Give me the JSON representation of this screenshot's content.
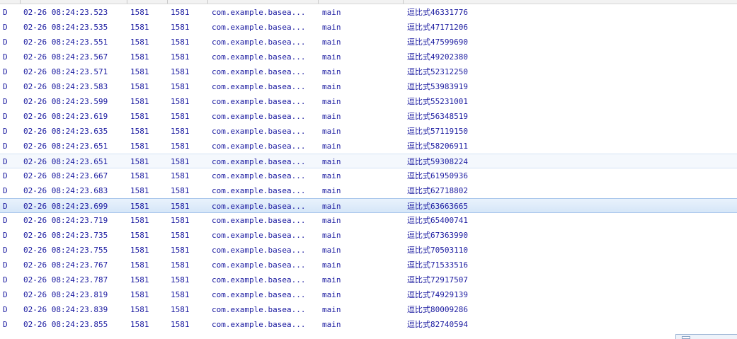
{
  "logcat": {
    "rows": [
      {
        "level": "D",
        "time": "02-26 08:24:23.523",
        "pid": "1581",
        "tid": "1581",
        "application": "com.example.basea...",
        "tag": "main",
        "text": "逗比式46331776"
      },
      {
        "level": "D",
        "time": "02-26 08:24:23.535",
        "pid": "1581",
        "tid": "1581",
        "application": "com.example.basea...",
        "tag": "main",
        "text": "逗比式47171206"
      },
      {
        "level": "D",
        "time": "02-26 08:24:23.551",
        "pid": "1581",
        "tid": "1581",
        "application": "com.example.basea...",
        "tag": "main",
        "text": "逗比式47599690"
      },
      {
        "level": "D",
        "time": "02-26 08:24:23.567",
        "pid": "1581",
        "tid": "1581",
        "application": "com.example.basea...",
        "tag": "main",
        "text": "逗比式49202380"
      },
      {
        "level": "D",
        "time": "02-26 08:24:23.571",
        "pid": "1581",
        "tid": "1581",
        "application": "com.example.basea...",
        "tag": "main",
        "text": "逗比式52312250"
      },
      {
        "level": "D",
        "time": "02-26 08:24:23.583",
        "pid": "1581",
        "tid": "1581",
        "application": "com.example.basea...",
        "tag": "main",
        "text": "逗比式53983919"
      },
      {
        "level": "D",
        "time": "02-26 08:24:23.599",
        "pid": "1581",
        "tid": "1581",
        "application": "com.example.basea...",
        "tag": "main",
        "text": "逗比式55231001"
      },
      {
        "level": "D",
        "time": "02-26 08:24:23.619",
        "pid": "1581",
        "tid": "1581",
        "application": "com.example.basea...",
        "tag": "main",
        "text": "逗比式56348519"
      },
      {
        "level": "D",
        "time": "02-26 08:24:23.635",
        "pid": "1581",
        "tid": "1581",
        "application": "com.example.basea...",
        "tag": "main",
        "text": "逗比式57119150"
      },
      {
        "level": "D",
        "time": "02-26 08:24:23.651",
        "pid": "1581",
        "tid": "1581",
        "application": "com.example.basea...",
        "tag": "main",
        "text": "逗比式58206911"
      },
      {
        "level": "D",
        "time": "02-26 08:24:23.651",
        "pid": "1581",
        "tid": "1581",
        "application": "com.example.basea...",
        "tag": "main",
        "text": "逗比式59308224"
      },
      {
        "level": "D",
        "time": "02-26 08:24:23.667",
        "pid": "1581",
        "tid": "1581",
        "application": "com.example.basea...",
        "tag": "main",
        "text": "逗比式61950936"
      },
      {
        "level": "D",
        "time": "02-26 08:24:23.683",
        "pid": "1581",
        "tid": "1581",
        "application": "com.example.basea...",
        "tag": "main",
        "text": "逗比式62718802"
      },
      {
        "level": "D",
        "time": "02-26 08:24:23.699",
        "pid": "1581",
        "tid": "1581",
        "application": "com.example.basea...",
        "tag": "main",
        "text": "逗比式63663665"
      },
      {
        "level": "D",
        "time": "02-26 08:24:23.719",
        "pid": "1581",
        "tid": "1581",
        "application": "com.example.basea...",
        "tag": "main",
        "text": "逗比式65400741"
      },
      {
        "level": "D",
        "time": "02-26 08:24:23.735",
        "pid": "1581",
        "tid": "1581",
        "application": "com.example.basea...",
        "tag": "main",
        "text": "逗比式67363990"
      },
      {
        "level": "D",
        "time": "02-26 08:24:23.755",
        "pid": "1581",
        "tid": "1581",
        "application": "com.example.basea...",
        "tag": "main",
        "text": "逗比式70503110"
      },
      {
        "level": "D",
        "time": "02-26 08:24:23.767",
        "pid": "1581",
        "tid": "1581",
        "application": "com.example.basea...",
        "tag": "main",
        "text": "逗比式71533516"
      },
      {
        "level": "D",
        "time": "02-26 08:24:23.787",
        "pid": "1581",
        "tid": "1581",
        "application": "com.example.basea...",
        "tag": "main",
        "text": "逗比式72917507"
      },
      {
        "level": "D",
        "time": "02-26 08:24:23.819",
        "pid": "1581",
        "tid": "1581",
        "application": "com.example.basea...",
        "tag": "main",
        "text": "逗比式74929139"
      },
      {
        "level": "D",
        "time": "02-26 08:24:23.839",
        "pid": "1581",
        "tid": "1581",
        "application": "com.example.basea...",
        "tag": "main",
        "text": "逗比式80009286"
      },
      {
        "level": "D",
        "time": "02-26 08:24:23.855",
        "pid": "1581",
        "tid": "1581",
        "application": "com.example.basea...",
        "tag": "main",
        "text": "逗比式82740594"
      }
    ],
    "hover_row": 10,
    "selected_row": 13
  },
  "colors": {
    "text": "#1a1aa0",
    "selected_row_bg": "#dbe8f8",
    "hover_row_bg": "#f4f8fd"
  }
}
